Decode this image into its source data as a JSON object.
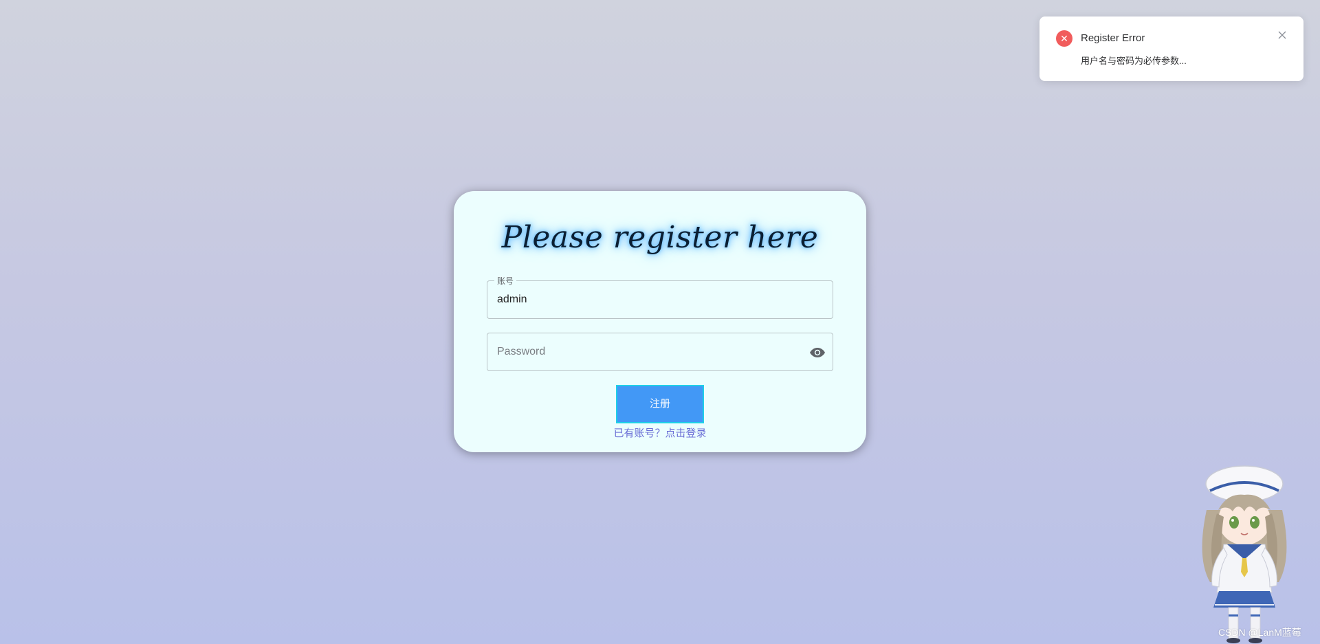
{
  "notification": {
    "title": "Register Error",
    "message": "用户名与密码为必传参数...",
    "icon": "error-icon",
    "close_icon": "close-icon",
    "accent_color": "#f15c5c"
  },
  "register_form": {
    "title": "Please register here",
    "username": {
      "label": "账号",
      "value": "admin"
    },
    "password": {
      "placeholder": "Password",
      "value": ""
    },
    "submit_label": "注册",
    "login_link": "已有账号？点击登录",
    "button_color": "#4298f6",
    "link_color": "#6a6ed6"
  },
  "mascot": {
    "description_icon": "chibi-sailor-girl-mascot"
  },
  "watermark": {
    "text": "CSDN @LanM蓝莓"
  }
}
